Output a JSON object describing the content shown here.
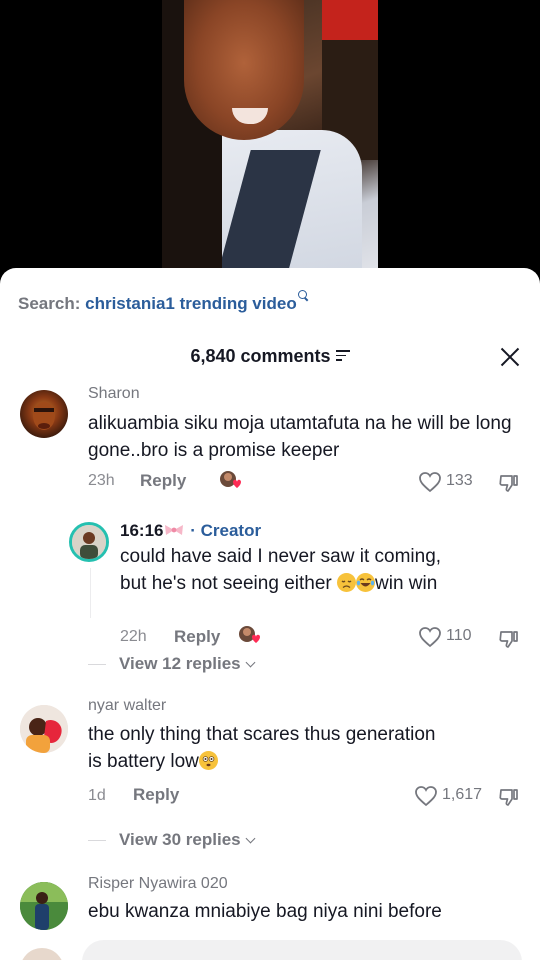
{
  "search": {
    "prefix": "Search:",
    "term": "christania1 trending video"
  },
  "header": {
    "comments_count": "6,840 comments"
  },
  "comments": [
    {
      "username": "Sharon",
      "text": "alikuambia siku moja utamtafuta na he will be long gone..bro is a promise keeper",
      "time": "23h",
      "reply_label": "Reply",
      "likes": "133"
    },
    {
      "username": "16:16",
      "creator_label": "· Creator",
      "text_line1": "could have said I never saw it coming,",
      "text_line2_a": "but he's not seeing either ",
      "text_line2_b": "win win",
      "time": "22h",
      "reply_label": "Reply",
      "likes": "110"
    },
    {
      "username": "nyar walter",
      "text_line1": "the only thing that scares thus generation",
      "text_line2": "is battery low",
      "time": "1d",
      "reply_label": "Reply",
      "likes": "1,617"
    },
    {
      "username": "Risper Nyawira 020",
      "text": "ebu kwanza mniabiye bag niya nini before"
    }
  ],
  "view_replies": [
    {
      "label": "View 12 replies"
    },
    {
      "label": "View 30 replies"
    }
  ],
  "colors": {
    "link_blue": "#2b5d9b",
    "muted_gray": "#75777e",
    "text_dark": "#161823"
  }
}
